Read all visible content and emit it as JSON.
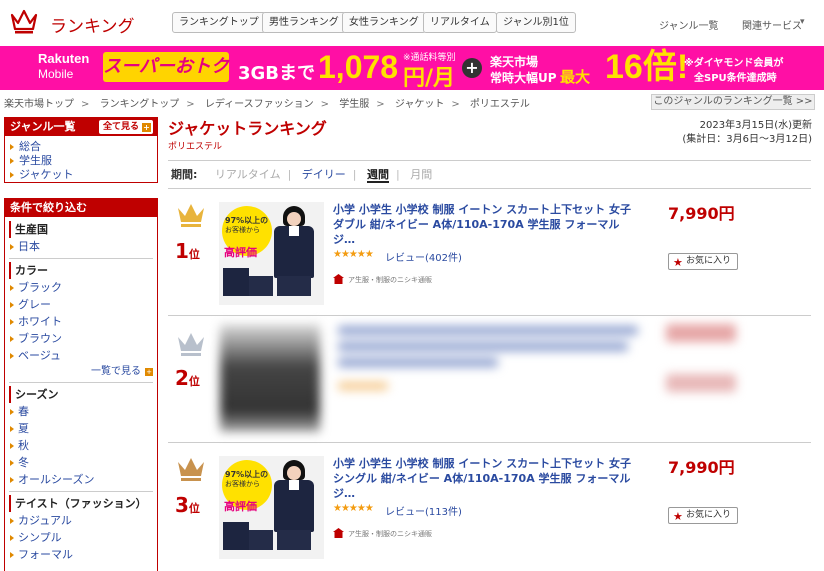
{
  "header": {
    "logo_text": "ランキング",
    "tabs": [
      "ランキングトップ",
      "男性ランキング",
      "女性ランキング",
      "リアルタイム",
      "ジャンル別1位"
    ],
    "links": [
      "ジャンル一覧",
      "関連サービス"
    ]
  },
  "banner": {
    "brand": "Rakuten",
    "brand_sub": "Mobile",
    "super_deal": "スーパーおトク",
    "gb_text": "3GBまで",
    "price": "1,078",
    "price_note": "※通話料等別",
    "unit": "円/月",
    "plus": "+",
    "rakuten_line1": "楽天市場",
    "rakuten_line2": "常時大幅UP",
    "max_label": "最大",
    "multiplier": "16倍!",
    "diamond_line1": "※ダイヤモンド会員が",
    "diamond_line2": "全SPU条件達成時"
  },
  "breadcrumb": [
    "楽天市場トップ",
    "ランキングトップ",
    "レディースファッション",
    "学生服",
    "ジャケット",
    "ポリエステル"
  ],
  "genre_ranking_link": "このジャンルのランキング一覧 >>",
  "sidebar": {
    "genre_title": "ジャンル一覧",
    "see_all": "全て見る",
    "genre_items": [
      "総合",
      "学生服",
      "ジャケット"
    ],
    "filter_title": "条件で絞り込む",
    "sections": [
      {
        "title": "生産国",
        "items": [
          "日本"
        ]
      },
      {
        "title": "カラー",
        "items": [
          "ブラック",
          "グレー",
          "ホワイト",
          "ブラウン",
          "ベージュ"
        ],
        "more": "一覧で見る"
      },
      {
        "title": "シーズン",
        "items": [
          "春",
          "夏",
          "秋",
          "冬",
          "オールシーズン"
        ]
      },
      {
        "title": "テイスト（ファッション）",
        "items": [
          "カジュアル",
          "シンプル",
          "フォーマル"
        ]
      }
    ]
  },
  "main": {
    "title": "ジャケットランキング",
    "subtitle": "ポリエステル",
    "updated_line1": "2023年3月15日(水)更新",
    "updated_line2": "(集計日：3月6日～3月12日)",
    "period_label": "期間:",
    "periods": [
      "リアルタイム",
      "デイリー",
      "週間",
      "月間"
    ]
  },
  "rankings": [
    {
      "rank": "1",
      "rank_suffix": "位",
      "title": "小学 小学生 小学校 制服 イートン スカート上下セット 女子 ダブル 紺/ネイビー A体/110A-170A 学生服 フォーマル ジ…",
      "stars": "★★★★★",
      "review": "レビュー(402件)",
      "shop": "ア生服・制服のニシキ通販",
      "price": "7,990円",
      "fav": "お気に入り",
      "badge": [
        "97%以上の",
        "お客様から",
        "高評価"
      ],
      "crown_color": "#e8b43c"
    },
    {
      "rank": "2",
      "rank_suffix": "位",
      "crown_color": "#b8c0cc"
    },
    {
      "rank": "3",
      "rank_suffix": "位",
      "title": "小学 小学生 小学校 制服 イートン スカート上下セット 女子 シングル 紺/ネイビー A体/110A-170A 学生服 フォーマル ジ…",
      "stars": "★★★★★",
      "review": "レビュー(113件)",
      "shop": "ア生服・制服のニシキ通販",
      "price": "7,990円",
      "fav": "お気に入り",
      "badge": [
        "97%以上の",
        "お客様から",
        "高評価"
      ],
      "crown_color": "#c8924e"
    }
  ],
  "colors": {
    "brand_red": "#bf0000",
    "banner_pink": "#ff0fa5",
    "banner_yellow": "#ffe100"
  }
}
